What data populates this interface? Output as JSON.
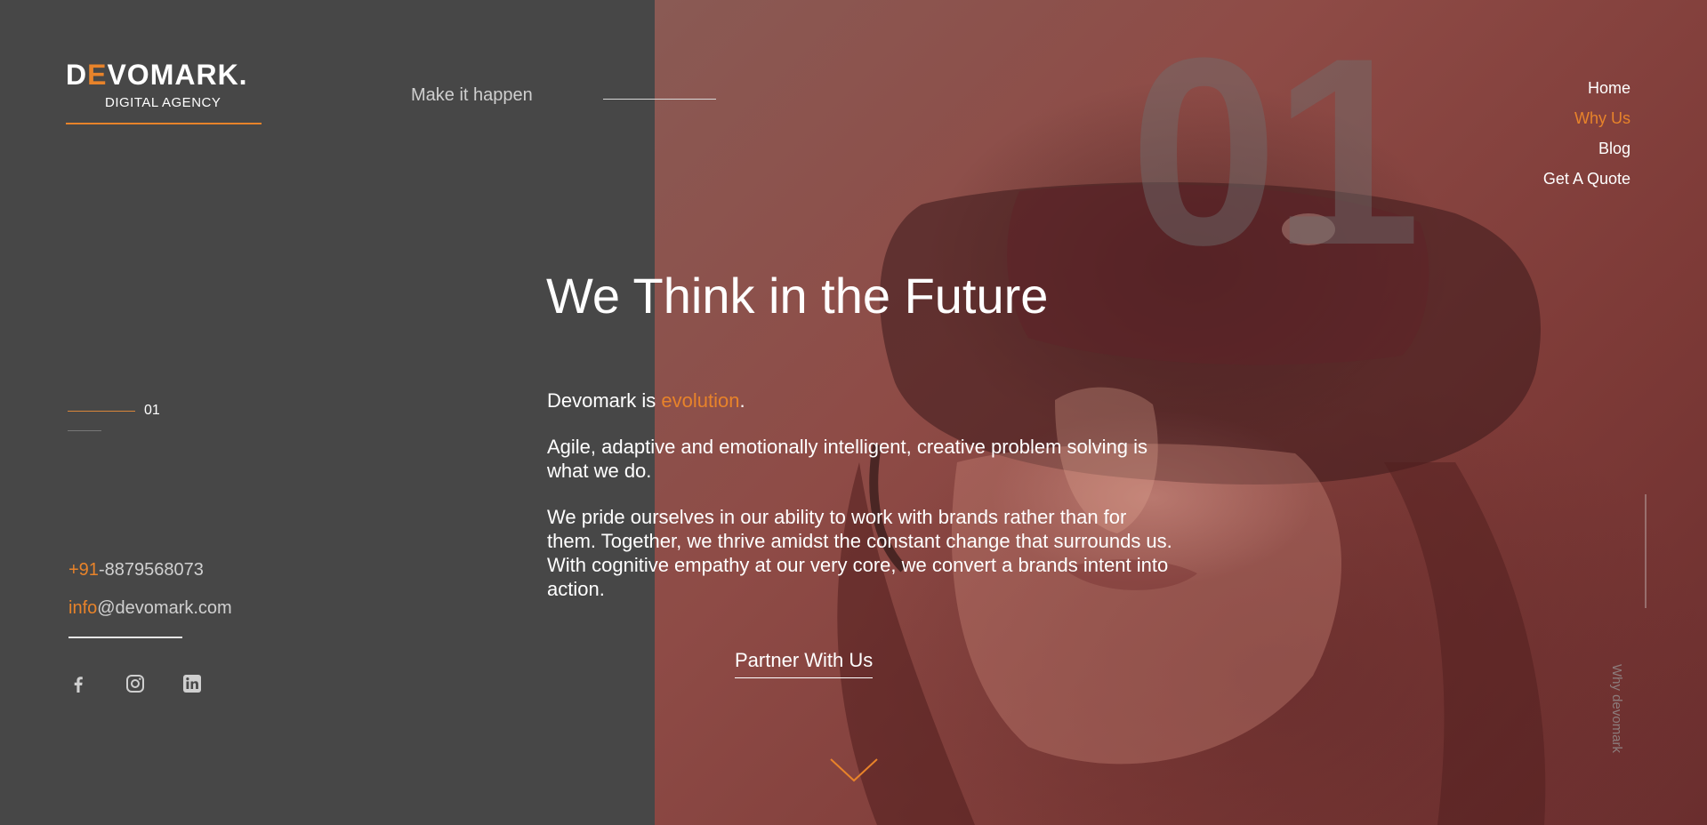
{
  "brand": {
    "logo_text_pre": "D",
    "logo_text_e": "E",
    "logo_text_post": "VOMARK.",
    "subtitle": "DIGITAL AGENCY",
    "accent_color": "#e8832a"
  },
  "header": {
    "tagline": "Make it happen"
  },
  "nav": {
    "items": [
      {
        "label": "Home",
        "active": false
      },
      {
        "label": "Why Us",
        "active": true
      },
      {
        "label": "Blog",
        "active": false
      },
      {
        "label": "Get A Quote",
        "active": false
      }
    ]
  },
  "hero": {
    "big_number": "01",
    "headline": "We Think in the Future",
    "intro_pre": "Devomark is ",
    "intro_highlight": "evolution",
    "intro_post": ".",
    "paragraph_1": "Agile, adaptive and emotionally intelligent, creative problem solving is what we do.",
    "paragraph_2": "We pride ourselves in our ability to work with brands rather than for them. Together, we thrive amidst the constant change that surrounds us. With cognitive empathy at our very core, we convert a brands intent into action.",
    "cta_label": "Partner With Us",
    "side_label": "Why devomark"
  },
  "slider": {
    "current": "01"
  },
  "contact": {
    "phone_code": "+91",
    "phone_number": "-8879568073",
    "email_user": "info",
    "email_domain": "@devomark.com"
  },
  "socials": [
    {
      "icon": "facebook-icon"
    },
    {
      "icon": "instagram-icon"
    },
    {
      "icon": "linkedin-icon"
    }
  ]
}
